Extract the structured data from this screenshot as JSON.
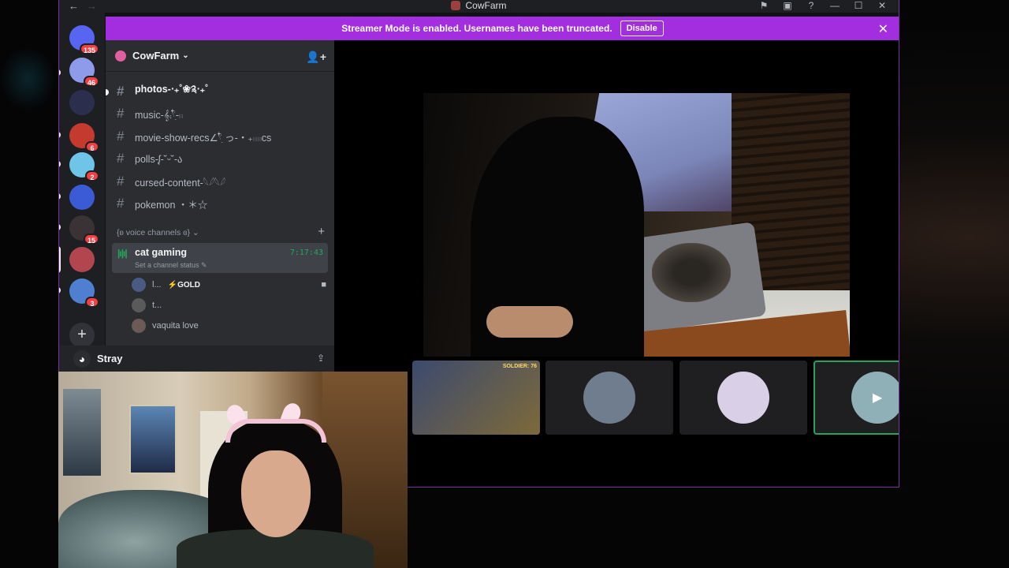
{
  "window": {
    "title": "CowFarm",
    "nav_back": "←",
    "nav_forward": "→",
    "controls": [
      "⚑",
      "▣",
      "?",
      "—",
      "☐",
      "✕"
    ]
  },
  "banner": {
    "text": "Streamer Mode is enabled. Usernames have been truncated.",
    "button": "Disable",
    "close": "✕",
    "color": "#a32ee0"
  },
  "servers": [
    {
      "badge": "135",
      "color": "#5865f2"
    },
    {
      "badge": "46",
      "color": "#8e9bea"
    },
    {
      "badge": "",
      "color": "#2b2f4d"
    },
    {
      "badge": "6",
      "color": "#c43a2f"
    },
    {
      "badge": "2",
      "color": "#6ec5e8"
    },
    {
      "badge": "",
      "color": "#3b5bd6"
    },
    {
      "badge": "15",
      "color": "#3a3235"
    },
    {
      "badge": "",
      "color": "#b3454f"
    },
    {
      "badge": "3",
      "color": "#4f7fd0"
    }
  ],
  "add_server": "+",
  "guild": {
    "name": "CowFarm",
    "chevron": "⌄",
    "invite_icon": "👤+"
  },
  "channels": [
    {
      "name": "photos-‧₊˚❀༉‧₊˚",
      "unread": true
    },
    {
      "name": "music-𝄞⨾𓍢ִ໋-𓏼",
      "unread": false
    },
    {
      "name": "movie-show-recs∠𓍢ִ໋ っ-‧₊𓏼𓏼cs",
      "unread": false
    },
    {
      "name": "polls-ᶘ-˘ᵕ˘-ა",
      "unread": false
    },
    {
      "name": "cursed-content-𓆩𓆪𓆩𓆪",
      "unread": false
    },
    {
      "name": "pokemon ・＊☆",
      "unread": false
    }
  ],
  "voice_category": {
    "label": "{ʚ voice channels ɞ} ⌄",
    "add": "+"
  },
  "voice_channel": {
    "name": "cat gaming",
    "time": "7:17:43",
    "status": "Set a channel status ✎"
  },
  "voice_users": [
    {
      "name": "l...",
      "tag": "⚡GOLD",
      "avatar_color": "#4a5a82"
    },
    {
      "name": "t...",
      "tag": "",
      "avatar_color": "#5a5a5a"
    },
    {
      "name": "vaquita love",
      "tag": "",
      "avatar_color": "#6b5a55"
    }
  ],
  "voice_cam_icon": "■",
  "user_panel": {
    "name": "Stray",
    "avatar_glyph": "◕",
    "share_icon": "⇪"
  },
  "tiles": [
    {
      "type": "game",
      "game_tag": "SOLDIER: 76",
      "color": "#3c4a6e"
    },
    {
      "type": "avatar",
      "color": "#6f7d8e"
    },
    {
      "type": "avatar",
      "color": "#d9cfe6"
    },
    {
      "type": "camera",
      "color": "#8fb0b6",
      "speaking": true,
      "cam_icon": "▶",
      "more": "⋯"
    }
  ]
}
